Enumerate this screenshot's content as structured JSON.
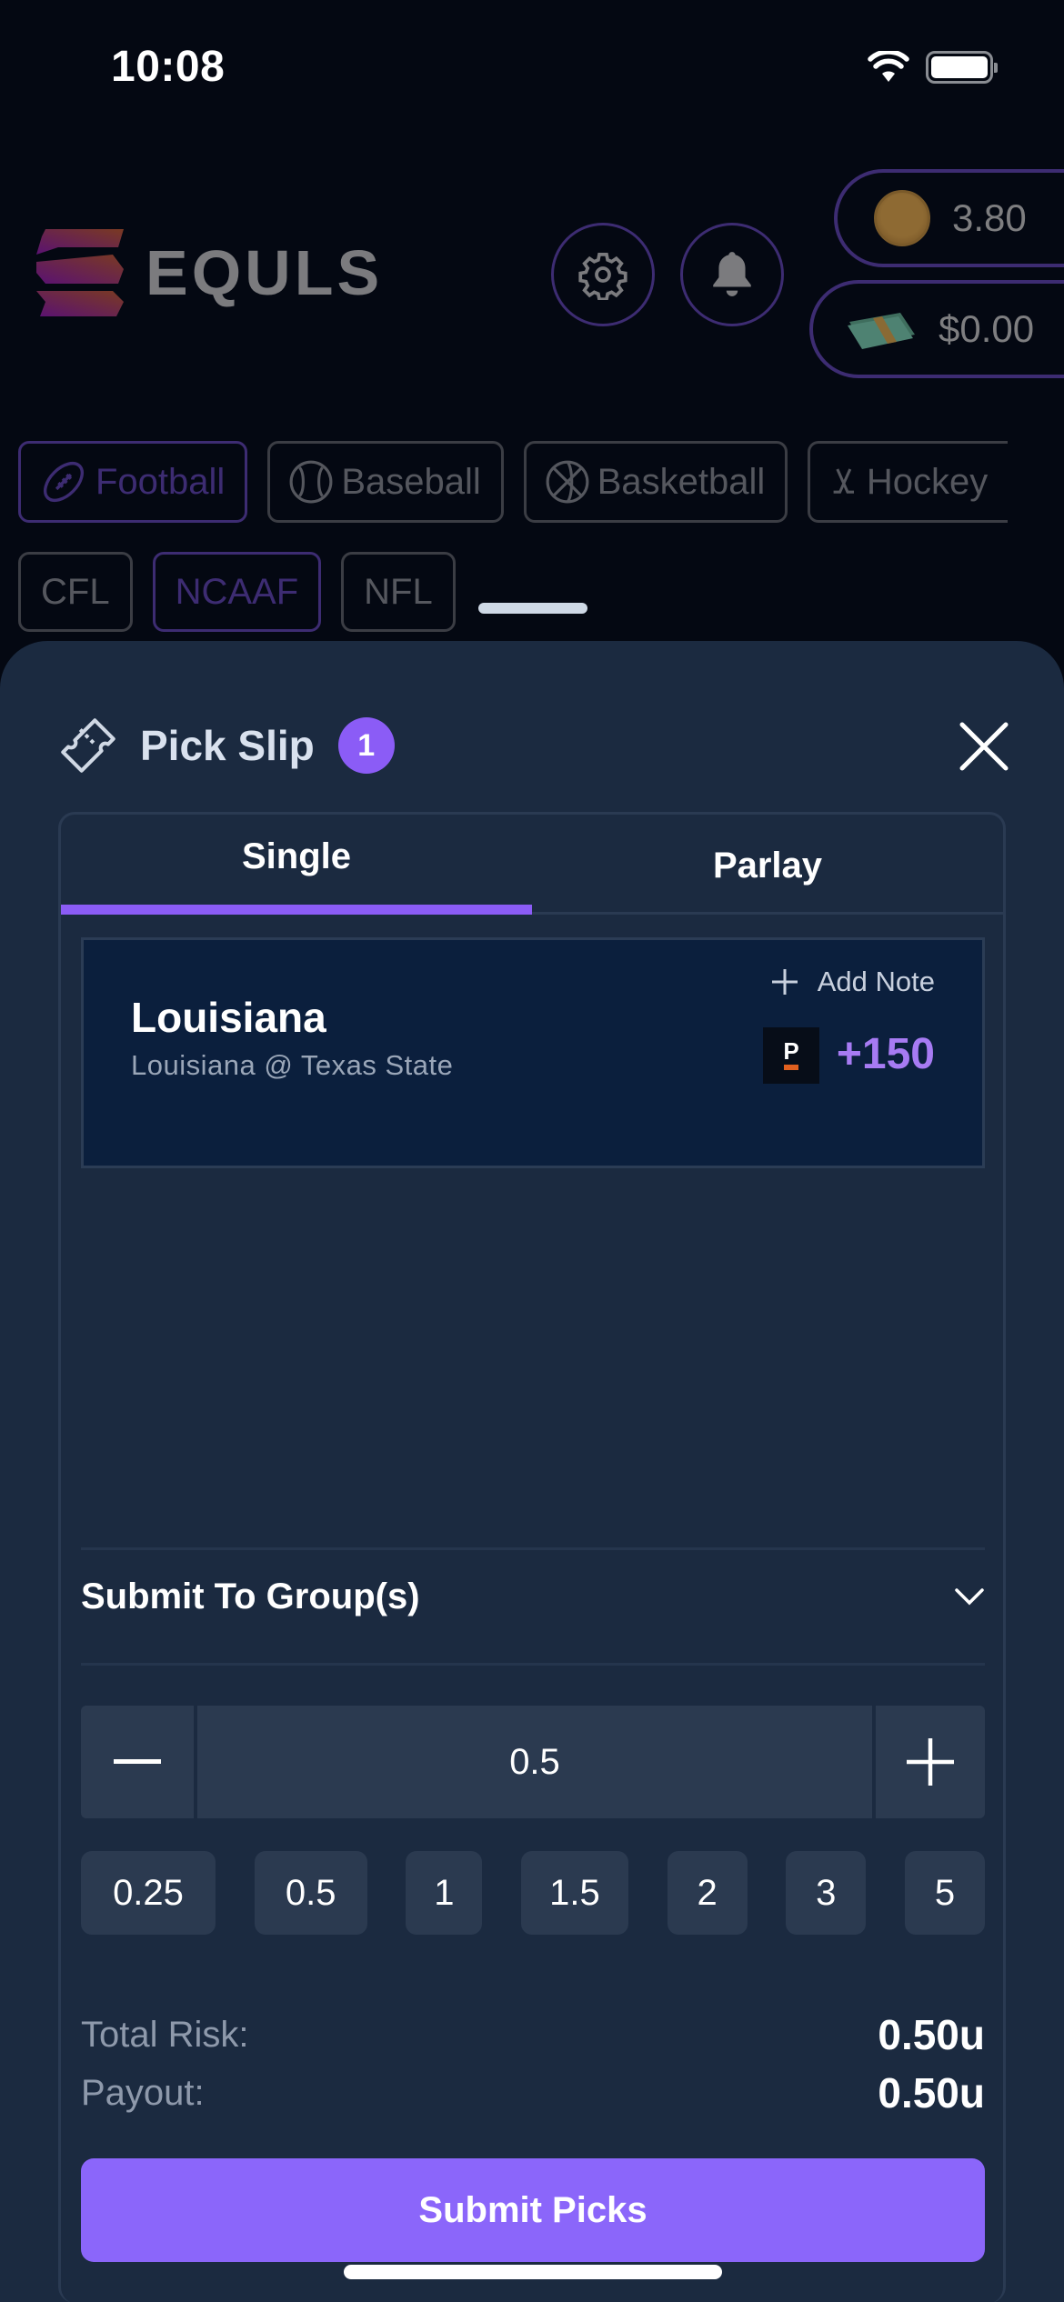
{
  "status_bar": {
    "time": "10:08"
  },
  "header": {
    "brand": "EQULS",
    "coins_balance": "3.80",
    "cash_balance": "$0.00"
  },
  "sports": [
    {
      "label": "Football",
      "icon": "football-icon",
      "active": true
    },
    {
      "label": "Baseball",
      "icon": "baseball-icon",
      "active": false
    },
    {
      "label": "Basketball",
      "icon": "basketball-icon",
      "active": false
    },
    {
      "label": "Hockey",
      "icon": "hockey-icon",
      "active": false
    }
  ],
  "leagues": [
    {
      "label": "CFL",
      "active": false
    },
    {
      "label": "NCAAF",
      "active": true
    },
    {
      "label": "NFL",
      "active": false
    }
  ],
  "pick_slip": {
    "title": "Pick Slip",
    "count": "1",
    "tabs": [
      {
        "label": "Single",
        "active": true
      },
      {
        "label": "Parlay",
        "active": false
      }
    ],
    "picks": [
      {
        "team": "Louisiana",
        "matchup": "Louisiana @ Texas State",
        "add_note_label": "Add Note",
        "sportsbook_letter": "P",
        "odds": "+150"
      }
    ],
    "submit_group_label": "Submit To Group(s)",
    "stake_value": "0.5",
    "presets": [
      "0.25",
      "0.5",
      "1",
      "1.5",
      "2",
      "3",
      "5"
    ],
    "total_risk_label": "Total Risk:",
    "total_risk_value": "0.50u",
    "payout_label": "Payout:",
    "payout_value": "0.50u",
    "submit_label": "Submit Picks"
  },
  "colors": {
    "accent": "#8b5cf6",
    "odds": "#a77bf3",
    "sheet_bg": "#1b2a40",
    "card_bg": "#0b1f3d"
  }
}
